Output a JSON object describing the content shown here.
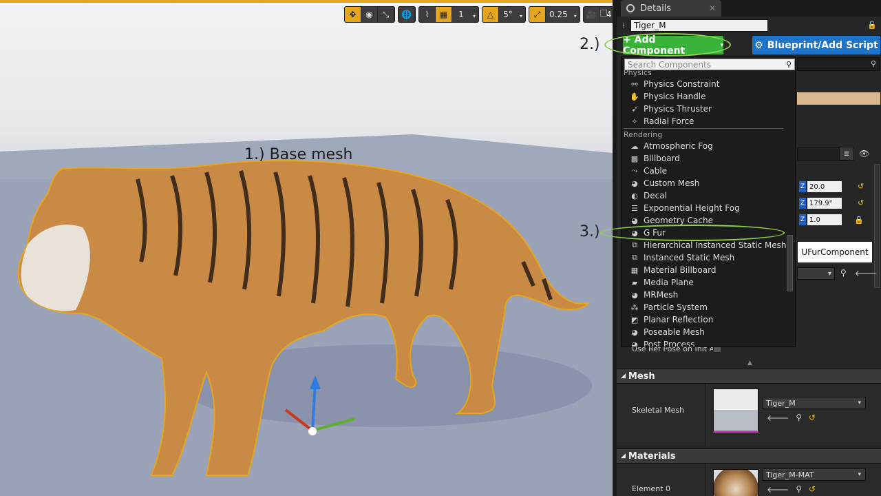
{
  "colors": {
    "accent_orange": "#e6a51b",
    "add_component_green": "#3ab33a",
    "blueprint_blue": "#1c73c8",
    "annotation_green": "#8fd14a"
  },
  "viewport": {
    "toolbar": {
      "grid_value": "1",
      "rotation_snap": "5°",
      "scale_snap": "0.25",
      "camera_speed": "4"
    },
    "annotations": {
      "step1": "1.) Base mesh",
      "step2": "2.)",
      "step3": "3.)"
    }
  },
  "details": {
    "tab_label": "Details",
    "actor_name": "Tiger_M",
    "add_component_label": "+ Add Component",
    "blueprint_label": "Blueprint/Add Script",
    "transform_values": [
      "20.0",
      "179.9°",
      "1.0"
    ],
    "use_ref_pose_label": "Use Ref Pose on Init A",
    "mesh": {
      "header": "Mesh",
      "skeletal_mesh_label": "Skeletal Mesh",
      "skeletal_mesh_value": "Tiger_M"
    },
    "materials": {
      "header": "Materials",
      "element_label": "Element 0",
      "element_value": "Tiger_M-MAT"
    },
    "tooltip": "UFurComponent"
  },
  "menu": {
    "search_placeholder": "Search Components",
    "categories": [
      {
        "name": "Physics",
        "items": [
          "Physics Constraint",
          "Physics Handle",
          "Physics Thruster",
          "Radial Force"
        ]
      },
      {
        "name": "Rendering",
        "items": [
          "Atmospheric Fog",
          "Billboard",
          "Cable",
          "Custom Mesh",
          "Decal",
          "Exponential Height Fog",
          "Geometry Cache",
          "G Fur",
          "Hierarchical Instanced Static Mesh",
          "Instanced Static Mesh",
          "Material Billboard",
          "Media Plane",
          "MRMesh",
          "Particle System",
          "Planar Reflection",
          "Poseable Mesh",
          "Post Process"
        ]
      }
    ]
  }
}
